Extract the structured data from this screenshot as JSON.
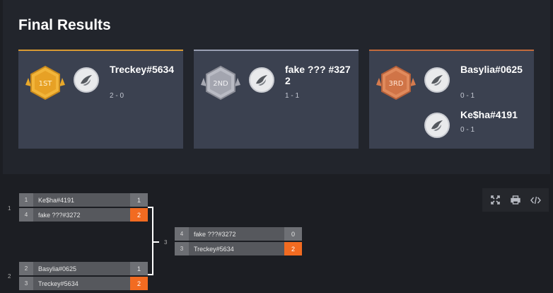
{
  "results": {
    "title": "Final Results",
    "cards": [
      {
        "medal_label": "1ST",
        "medal_color": "#e9a82a",
        "players": [
          {
            "name": "Treckey#5634",
            "record": "2 - 0"
          }
        ]
      },
      {
        "medal_label": "2ND",
        "medal_color": "#a7a9b3",
        "players": [
          {
            "name": "fake ??? #3272",
            "record": "1 - 1"
          }
        ]
      },
      {
        "medal_label": "3RD",
        "medal_color": "#d57b4e",
        "players": [
          {
            "name": "Basylia#0625",
            "record": "0 - 1"
          },
          {
            "name": "Ke$ha#4191",
            "record": "0 - 1"
          }
        ]
      }
    ]
  },
  "bracket": {
    "matches": [
      {
        "number": "1",
        "slots": [
          {
            "seed": "1",
            "name": "Ke$ha#4191",
            "score": "1",
            "winner": false
          },
          {
            "seed": "4",
            "name": "fake ???#3272",
            "score": "2",
            "winner": true
          }
        ]
      },
      {
        "number": "2",
        "slots": [
          {
            "seed": "2",
            "name": "Basylia#0625",
            "score": "1",
            "winner": false
          },
          {
            "seed": "3",
            "name": "Treckey#5634",
            "score": "2",
            "winner": true
          }
        ]
      },
      {
        "number": "3",
        "slots": [
          {
            "seed": "4",
            "name": "fake ???#3272",
            "score": "0",
            "winner": false
          },
          {
            "seed": "3",
            "name": "Treckey#5634",
            "score": "2",
            "winner": true
          }
        ]
      }
    ]
  },
  "toolbar": {
    "icons": [
      "expand-icon",
      "print-icon",
      "code-icon"
    ]
  },
  "colors": {
    "accent": "#f26b21",
    "gold": "#e9a82a",
    "silver": "#a7a9b3",
    "bronze": "#d57b4e"
  }
}
